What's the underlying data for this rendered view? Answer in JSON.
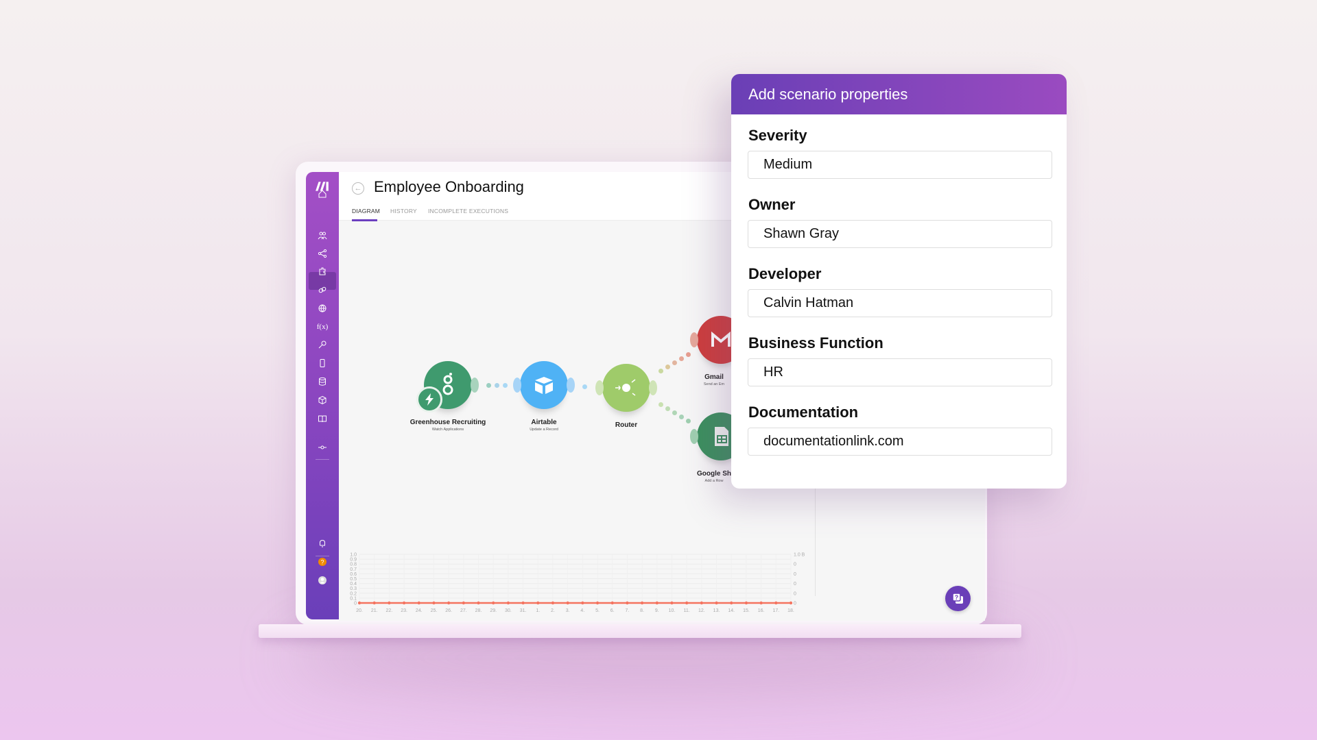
{
  "scenario": {
    "title": "Employee Onboarding",
    "tabs": [
      {
        "label": "DIAGRAM",
        "active": true
      },
      {
        "label": "HISTORY"
      },
      {
        "label": "INCOMPLETE EXECUTIONS"
      }
    ]
  },
  "sidebar": {
    "items": [
      "home-icon",
      "users-icon",
      "share-icon",
      "puzzle-icon",
      "link-icon",
      "globe-icon",
      "function-icon",
      "key-icon",
      "phone-icon",
      "database-icon",
      "cube-icon",
      "book-icon",
      "commit-icon",
      "bell-icon",
      "help-icon",
      "avatar-icon"
    ],
    "active": "share-icon",
    "function_glyph": "f(x)",
    "help_glyph": "?"
  },
  "diagram": {
    "nodes": [
      {
        "name": "Greenhouse Recruiting",
        "action": "Watch Applications",
        "color": "#3f9a6e"
      },
      {
        "name": "Airtable",
        "action": "Update a Record",
        "color": "#4fb2f5"
      },
      {
        "name": "Router",
        "action": "",
        "color": "#9fcb6a"
      },
      {
        "name": "Gmail",
        "action": "Send an Em",
        "color": "#cc3d3d"
      },
      {
        "name": "Google Sh",
        "action": "Add a Row",
        "color": "#3b8f5e"
      }
    ]
  },
  "chart_data": {
    "type": "line",
    "x": [
      "20.",
      "21.",
      "22.",
      "23.",
      "24.",
      "25.",
      "26.",
      "27.",
      "28.",
      "29.",
      "30.",
      "31.",
      "1.",
      "2.",
      "3.",
      "4.",
      "5.",
      "6.",
      "7.",
      "8.",
      "9.",
      "10.",
      "11.",
      "12.",
      "13.",
      "14.",
      "15.",
      "16.",
      "17.",
      "18."
    ],
    "values": [
      0,
      0,
      0,
      0,
      0,
      0,
      0,
      0,
      0,
      0,
      0,
      0,
      0,
      0,
      0,
      0,
      0,
      0,
      0,
      0,
      0,
      0,
      0,
      0,
      0,
      0,
      0,
      0,
      0,
      0
    ],
    "y_ticks": [
      "1.0",
      "0.9",
      "0.8",
      "0.7",
      "0.6",
      "0.5",
      "0.4",
      "0.3",
      "0.2",
      "0.1",
      "0"
    ],
    "y2_ticks": [
      "1.0 B",
      "0",
      "0",
      "0",
      "0",
      "0"
    ],
    "ylim": [
      0,
      1
    ],
    "grid": true,
    "color": "#f4735f"
  },
  "panel": {
    "title": "Add scenario properties",
    "fields": [
      {
        "label": "Severity",
        "value": "Medium"
      },
      {
        "label": "Owner",
        "value": "Shawn Gray"
      },
      {
        "label": "Developer",
        "value": "Calvin Hatman"
      },
      {
        "label": "Business Function",
        "value": "HR"
      },
      {
        "label": "Documentation",
        "value": "documentationlink.com"
      }
    ]
  },
  "colors": {
    "accent": "#6a3fb8",
    "sidebar_top": "#a34fc6",
    "sidebar_bottom": "#6a3fb9",
    "help_orange": "#f08a00"
  }
}
